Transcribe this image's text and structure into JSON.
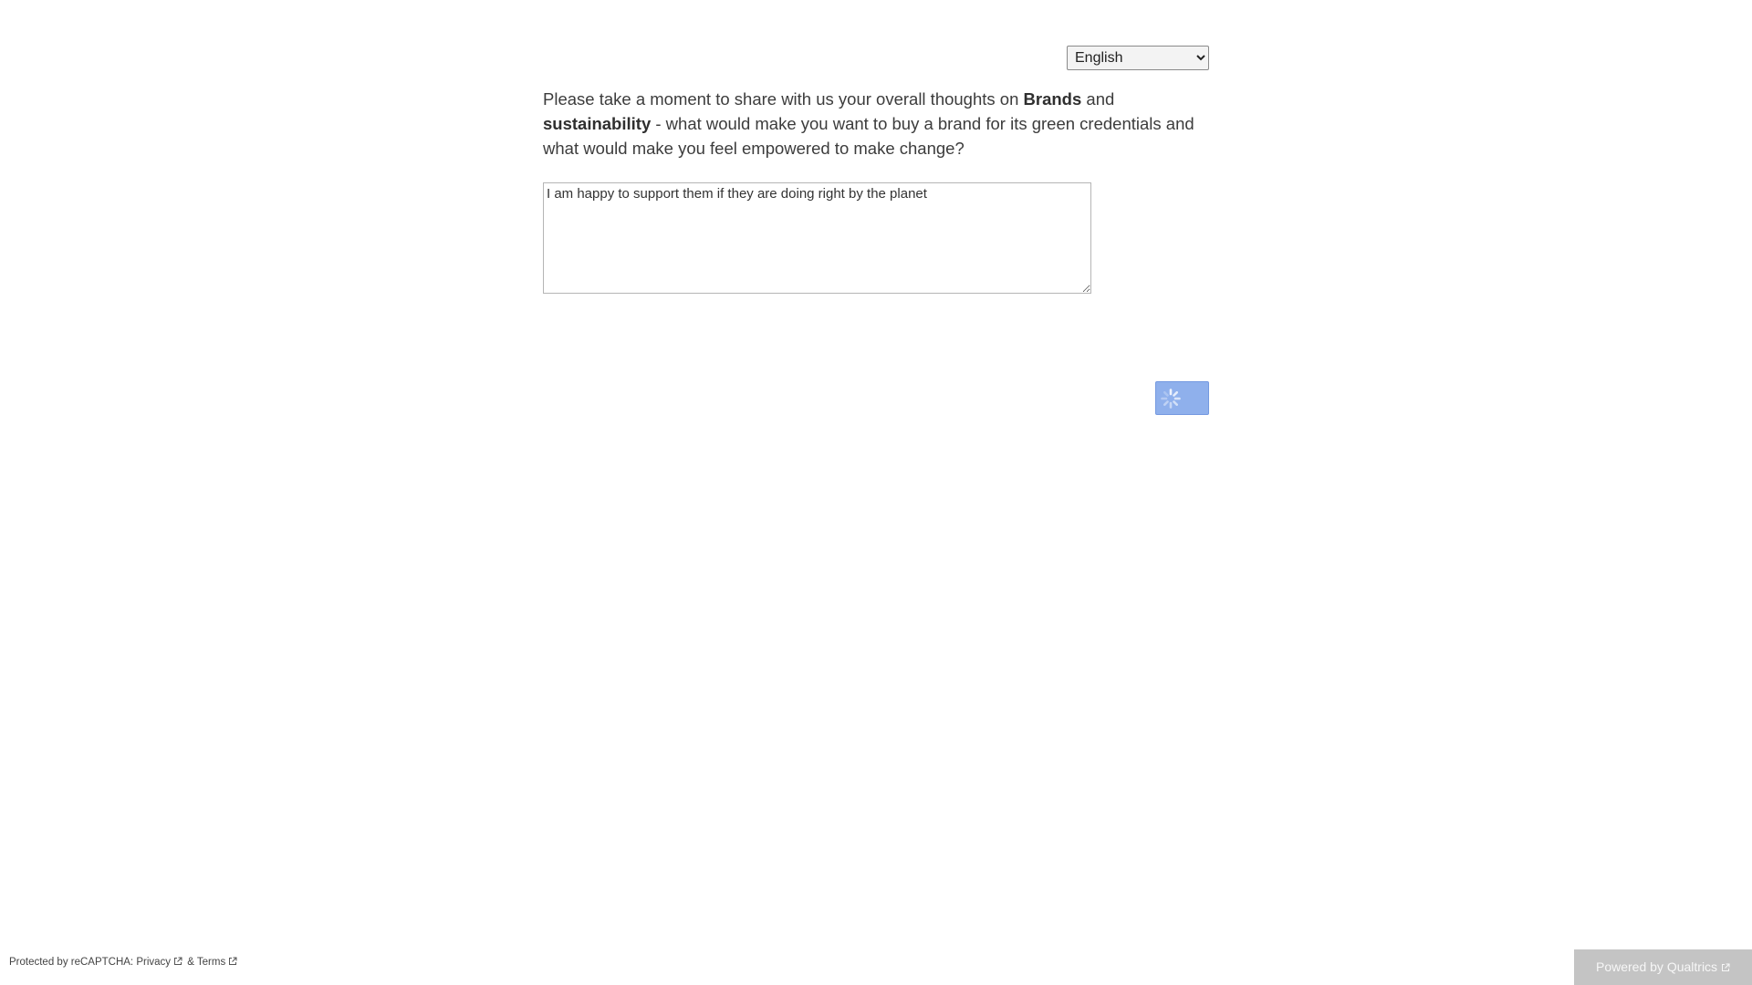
{
  "language_select": {
    "selected": "English",
    "options": [
      "English"
    ]
  },
  "question": {
    "text_before": "Please take a moment to share with us your overall thoughts on ",
    "bold_1": "Brands",
    "text_middle": " and ",
    "bold_2": "sustainability",
    "text_after": " - what would make you want to buy a brand for its green credentials and what would make you feel empowered to make change?"
  },
  "answer": {
    "value": "I am happy to support them if they are doing right by the planet"
  },
  "next_button": {
    "icon": "loading-spinner-icon",
    "state": "loading"
  },
  "recaptcha": {
    "prefix": "Protected by reCAPTCHA: ",
    "privacy_label": "Privacy",
    "separator": " & ",
    "terms_label": "Terms"
  },
  "footer": {
    "powered_by_label": "Powered by Qualtrics"
  },
  "colors": {
    "button_bg": "#8fb0ec",
    "powered_bg": "#c4c4c4"
  }
}
